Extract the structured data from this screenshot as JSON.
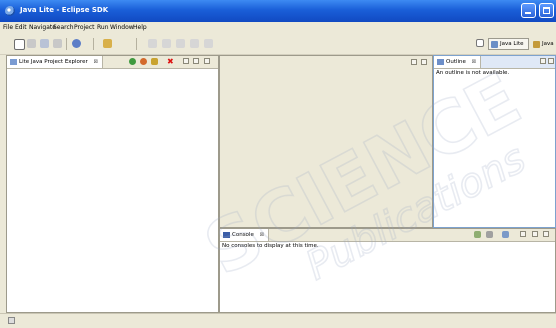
{
  "window": {
    "title": "Java Lite - Eclipse SDK"
  },
  "menu": [
    "File",
    "Edit",
    "Navigate",
    "Search",
    "Project",
    "Run",
    "Window",
    "Help"
  ],
  "perspectives": [
    {
      "label": "Java Lite"
    },
    {
      "label": "Java"
    }
  ],
  "explorer": {
    "tab_label": "Lite Java Project Explorer",
    "close": "⊠"
  },
  "outline": {
    "tab_label": "Outline",
    "close": "⊠",
    "message": "An outline is not available."
  },
  "console": {
    "tab_label": "Console",
    "close": "⊠",
    "message": "No consoles to display at this time."
  },
  "watermark": {
    "text1": "SCIENCE",
    "text2": "Publications"
  },
  "colors": {
    "titlebar": "#1a5fd8",
    "chrome": "#ece9d8",
    "outline_accent": "#7da2ce"
  }
}
